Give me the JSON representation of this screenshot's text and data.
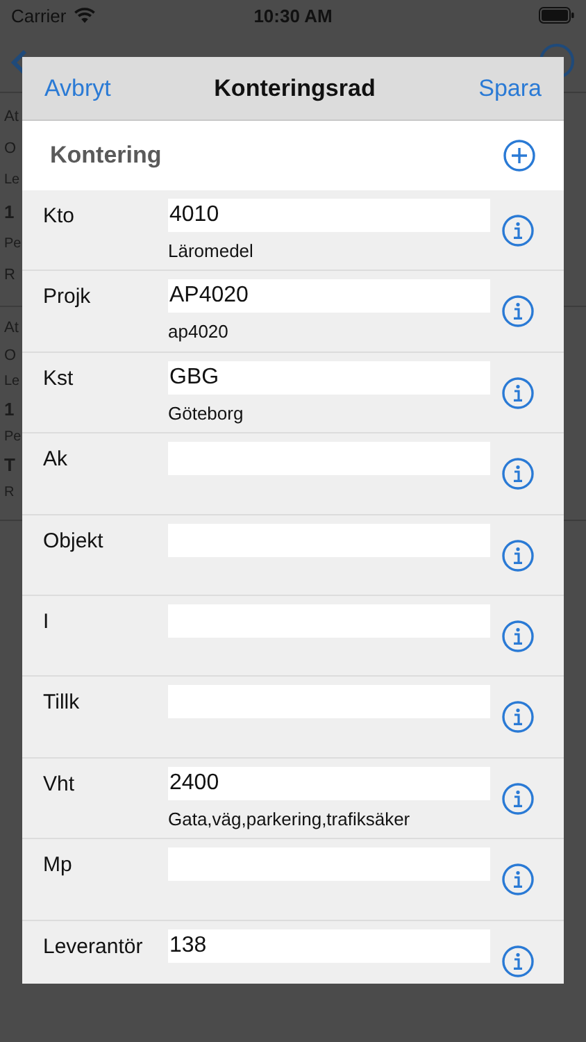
{
  "status_bar": {
    "carrier": "Carrier",
    "time": "10:30 AM"
  },
  "background": {
    "groups": [
      [
        {
          "text": "At",
          "kind": "label"
        },
        {
          "text": "O",
          "kind": "label"
        },
        {
          "text": "Le",
          "kind": "small"
        },
        {
          "text": "1",
          "kind": "big"
        },
        {
          "text": "Pe",
          "kind": "small"
        },
        {
          "text": "R",
          "kind": "label"
        }
      ],
      [
        {
          "text": "At",
          "kind": "label"
        },
        {
          "text": "O",
          "kind": "label"
        },
        {
          "text": "Le",
          "kind": "small"
        },
        {
          "text": "1",
          "kind": "big"
        },
        {
          "text": "Pe",
          "kind": "small"
        },
        {
          "text": "T",
          "kind": "big"
        },
        {
          "text": "R",
          "kind": "small"
        }
      ]
    ]
  },
  "sheet": {
    "cancel": "Avbryt",
    "title": "Konteringsrad",
    "save": "Spara",
    "section": "Kontering",
    "rows": [
      {
        "label": "Kto",
        "value": "4010",
        "description": "Läromedel"
      },
      {
        "label": "Projk",
        "value": "AP4020",
        "description": "ap4020"
      },
      {
        "label": "Kst",
        "value": "GBG",
        "description": "Göteborg"
      },
      {
        "label": "Ak"
      },
      {
        "label": "Objekt"
      },
      {
        "label": "I"
      },
      {
        "label": "Tillk"
      },
      {
        "label": "Vht",
        "value": "2400",
        "description": "Gata,väg,parkering,trafiksäker"
      },
      {
        "label": "Mp"
      },
      {
        "label": "Leverantör",
        "value": "138"
      }
    ]
  }
}
